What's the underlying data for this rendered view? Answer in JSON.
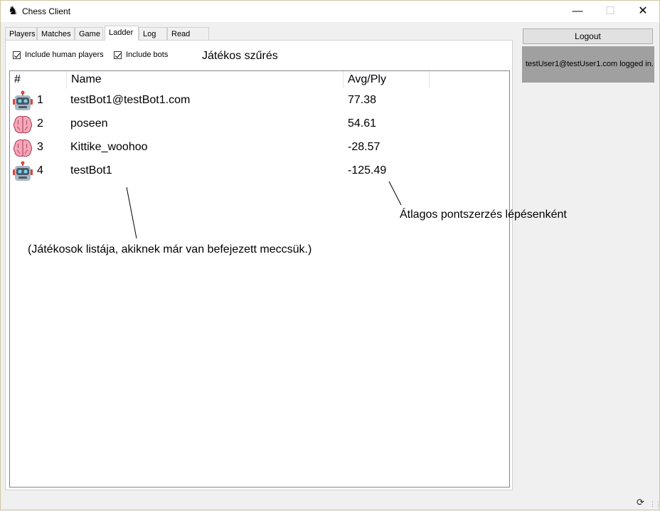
{
  "window": {
    "title": "Chess Client"
  },
  "tabs": [
    {
      "label": "Players"
    },
    {
      "label": "Matches"
    },
    {
      "label": "Game"
    },
    {
      "label": "Ladder"
    },
    {
      "label": "Log"
    },
    {
      "label": "Read me!"
    }
  ],
  "active_tab": "Ladder",
  "filters": {
    "include_humans": "Include human players",
    "include_bots": "Include bots",
    "caption": "Játékos szűrés"
  },
  "ladder": {
    "columns": [
      "#",
      "Name",
      "Avg/Ply"
    ],
    "rows": [
      {
        "icon": "robot-icon",
        "rank": "1",
        "name": "testBot1@testBot1.com",
        "score": "77.38"
      },
      {
        "icon": "brain-icon",
        "rank": "2",
        "name": "poseen",
        "score": "54.61"
      },
      {
        "icon": "brain-icon",
        "rank": "3",
        "name": "Kittike_woohoo",
        "score": "-28.57"
      },
      {
        "icon": "robot-icon",
        "rank": "4",
        "name": "testBot1",
        "score": "-125.49"
      }
    ]
  },
  "annotations": {
    "score_note": "Átlagos pontszerzés lépésenként",
    "list_note": "(Játékosok listája, akiknek már van befejezett meccsük.)"
  },
  "sidebar": {
    "logout_label": "Logout",
    "status": "testUser1@testUser1.com logged in."
  }
}
